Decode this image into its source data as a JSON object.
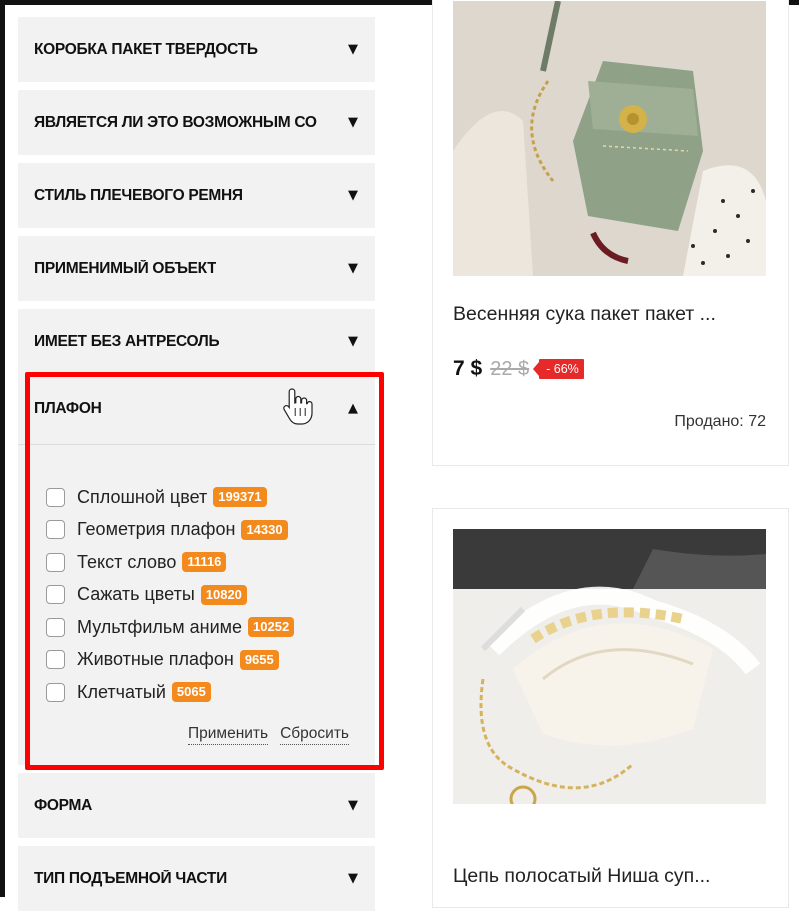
{
  "filters": {
    "collapsed_top": [
      {
        "label": "КОРОБКА ПАКЕТ ТВЕРДОСТЬ"
      },
      {
        "label": "ЯВЛЯЕТСЯ ЛИ ЭТО ВОЗМОЖНЫМ СО"
      },
      {
        "label": "СТИЛЬ ПЛЕЧЕВОГО РЕМНЯ"
      },
      {
        "label": "ПРИМЕНИМЫЙ ОБЪЕКТ"
      },
      {
        "label": "ИМЕЕТ БЕЗ АНТРЕСОЛЬ"
      }
    ],
    "open": {
      "label": "ПЛАФОН",
      "options": [
        {
          "label": "Сплошной цвет",
          "count": "199371"
        },
        {
          "label": "Геометрия плафон",
          "count": "14330"
        },
        {
          "label": "Текст слово",
          "count": "11116"
        },
        {
          "label": "Сажать цветы",
          "count": "10820"
        },
        {
          "label": "Мультфильм аниме",
          "count": "10252"
        },
        {
          "label": "Животные плафон",
          "count": "9655"
        },
        {
          "label": "Клетчатый",
          "count": "5065"
        }
      ],
      "apply_label": "Применить",
      "reset_label": "Сбросить"
    },
    "collapsed_bottom": [
      {
        "label": "ФОРМА"
      },
      {
        "label": "ТИП ПОДЪЕМНОЙ ЧАСТИ"
      }
    ],
    "caret_down": "▼",
    "caret_up": "▲"
  },
  "products": [
    {
      "title": "Весенняя сука пакет пакет ...",
      "price": "7 $",
      "old_price": "22 $",
      "discount": "- 66%",
      "sold_label": "Продано:",
      "sold_count": "72",
      "image_icon": "green-crossbody-bag-photo"
    },
    {
      "title": "Цепь полосатый Ниша суп...",
      "image_icon": "white-shoulder-bag-photo"
    }
  ],
  "colors": {
    "highlight": "#ff0000",
    "count_badge": "#f28a1d",
    "discount": "#e62a2a",
    "panel_bg": "#f2f2f2"
  }
}
